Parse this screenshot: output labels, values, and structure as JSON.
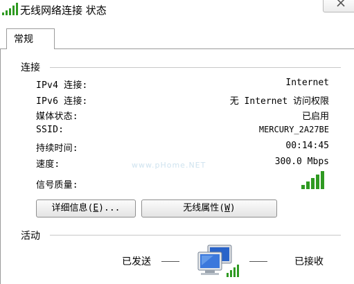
{
  "window": {
    "title": "无线网络连接 状态"
  },
  "tabs": [
    {
      "label": "常规"
    }
  ],
  "connection": {
    "section_title": "连接",
    "rows": [
      {
        "label": "IPv4 连接:",
        "value": "Internet"
      },
      {
        "label": "IPv6 连接:",
        "value": "无 Internet 访问权限"
      },
      {
        "label": "媒体状态:",
        "value": "已启用"
      },
      {
        "label": "SSID:",
        "value": "MERCURY_2A27BE"
      },
      {
        "label": "持续时间:",
        "value": "00:14:45"
      },
      {
        "label": "速度:",
        "value": "300.0 Mbps"
      }
    ],
    "signal_label": "信号质量:",
    "signal_bars": 5
  },
  "buttons": {
    "details": {
      "prefix": "详细信息(",
      "key": "E",
      "suffix": ")..."
    },
    "wireless": {
      "prefix": "无线属性(",
      "key": "W",
      "suffix": ")"
    }
  },
  "activity": {
    "section_title": "活动",
    "sent_label": "已发送",
    "received_label": "已接收"
  },
  "watermark": "www.pHome.NET",
  "colors": {
    "signal_green": "#2f9a22",
    "section_line": "#c8c8c8"
  }
}
